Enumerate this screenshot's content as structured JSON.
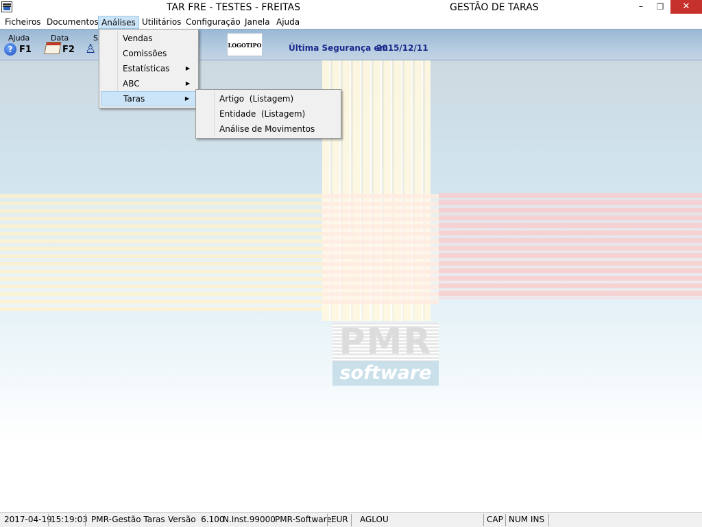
{
  "window": {
    "title": "TAR FRE - TESTES - FREITAS",
    "subtitle": "GESTÃO DE TARAS",
    "minimize_glyph": "–",
    "maximize_glyph": "❐",
    "close_glyph": "✕"
  },
  "menu": {
    "items": [
      "Ficheiros",
      "Documentos",
      "Análises",
      "Utilitários",
      "Configuração",
      "Janela",
      "Ajuda"
    ],
    "active": "Análises"
  },
  "toolbar": {
    "help_label": "Ajuda",
    "help_key": "F1",
    "help_icon": "?",
    "date_label": "Data",
    "date_key": "F2",
    "third_label": "S",
    "logo_text": "LOGOTIPO",
    "backup_label": "Última Segurança em",
    "backup_date": "2015/12/11"
  },
  "dropdown": {
    "items": [
      {
        "label": "Vendas",
        "submenu": false
      },
      {
        "label": "Comissões",
        "submenu": false
      },
      {
        "label": "Estatísticas",
        "submenu": true
      },
      {
        "label": "ABC",
        "submenu": true
      },
      {
        "label": "Taras",
        "submenu": true
      }
    ],
    "highlighted": "Taras"
  },
  "submenu": {
    "items": [
      "Artigo  (Listagem)",
      "Entidade  (Listagem)",
      "Análise de Movimentos"
    ]
  },
  "background": {
    "logo_top": "PMR",
    "logo_bottom": "software"
  },
  "statusbar": {
    "date": "2017-04-19",
    "time": "15:19:03",
    "app": "PMR-Gestão Taras",
    "version": "Versão  6.100",
    "inst": "N.Inst.99000",
    "vendor": "PMR-Software",
    "currency": "EUR",
    "user": "AGLOU",
    "caps": "CAP",
    "num_ins": "NUM INS"
  },
  "colors": {
    "menu_highlight": "#cce4f7",
    "close_button": "#c7312b",
    "backup_text": "#1a2a8c",
    "toolbar": "#b5cbe0"
  }
}
